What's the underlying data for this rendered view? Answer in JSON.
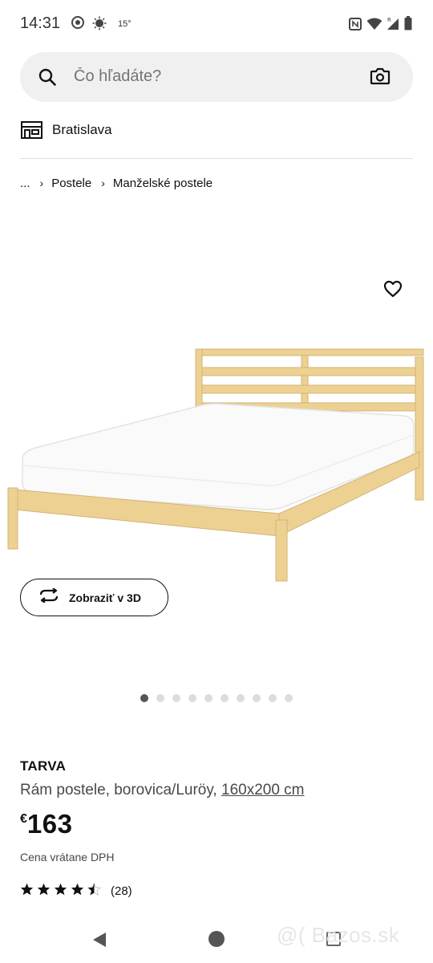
{
  "status_bar": {
    "time": "14:31",
    "temperature": "15°",
    "icons": [
      "chrome-icon",
      "weather-sun-icon",
      "nfc-icon",
      "wifi-icon",
      "signal-icon",
      "battery-icon"
    ]
  },
  "search": {
    "placeholder": "Čo hľadáte?",
    "icons": [
      "search-icon",
      "camera-icon"
    ]
  },
  "store": {
    "label": "Bratislava",
    "icon": "store-icon"
  },
  "breadcrumb": {
    "items": [
      "...",
      "Postele",
      "Manželské postele"
    ]
  },
  "gallery": {
    "view_3d_label": "Zobraziť v 3D",
    "dot_count": 10,
    "active_index": 0
  },
  "product": {
    "name": "TARVA",
    "description": "Rám postele, borovica/Luröy,",
    "size": "160x200 cm",
    "currency": "€",
    "price": "163",
    "vat_note": "Cena vrátane DPH",
    "rating_stars": 4.5,
    "rating_count": "(28)"
  },
  "watermark": "@( Bazos.sk",
  "colors": {
    "search_bg": "#f0f0f0",
    "pine": "#ecd193",
    "text": "#111111"
  }
}
